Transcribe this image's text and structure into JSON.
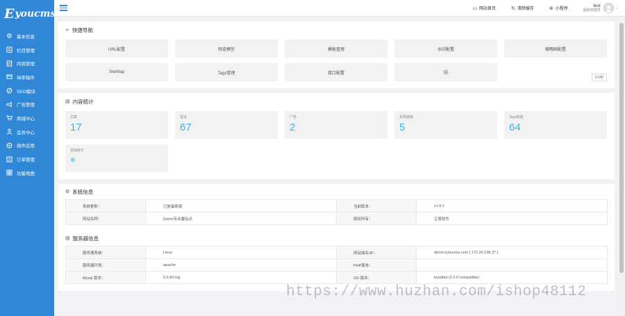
{
  "logo": {
    "text": "Eyoucms"
  },
  "sidebar": {
    "items": [
      {
        "label": "基本信息",
        "icon": "gear-icon"
      },
      {
        "label": "栏目管理",
        "icon": "sitemap-icon"
      },
      {
        "label": "内容管理",
        "icon": "document-icon"
      },
      {
        "label": "待审稿件",
        "icon": "pending-icon"
      },
      {
        "label": "SEO模块",
        "icon": "seo-icon"
      },
      {
        "label": "广告管理",
        "icon": "megaphone-icon"
      },
      {
        "label": "商城中心",
        "icon": "cart-icon"
      },
      {
        "label": "会员中心",
        "icon": "user-icon"
      },
      {
        "label": "插件应用",
        "icon": "plugin-icon"
      },
      {
        "label": "订单管理",
        "icon": "order-icon"
      },
      {
        "label": "功能地图",
        "icon": "grid-icon"
      }
    ]
  },
  "header": {
    "links": [
      {
        "label": "网站首页",
        "icon": "monitor-icon",
        "glyph": "▭"
      },
      {
        "label": "清除缓存",
        "icon": "refresh-icon",
        "glyph": "↻"
      },
      {
        "label": "小程序",
        "icon": "miniapp-icon",
        "glyph": "⊛"
      }
    ],
    "user": {
      "name": "test",
      "role": "超级管理员"
    }
  },
  "quick_nav": {
    "title": "快捷导航",
    "items": [
      "URL配置",
      "频道模型",
      "模板管理",
      "水印配置",
      "缩略图配置",
      "SiteMap",
      "Tags管理",
      "接口配置"
    ],
    "plus": "⊕",
    "sort_label": "0.5秒"
  },
  "content_stats": {
    "title": "内容统计",
    "items": [
      {
        "label": "文章",
        "value": "17"
      },
      {
        "label": "留言",
        "value": "67"
      },
      {
        "label": "广告",
        "value": "2"
      },
      {
        "label": "友情链接",
        "value": "5"
      },
      {
        "label": "Tags标签",
        "value": "64"
      }
    ],
    "add": {
      "label": "添加统计",
      "glyph": "⊕"
    }
  },
  "system_info": {
    "title": "系统信息",
    "rows": [
      [
        "系统更新：",
        "已是最新版",
        "当前版本：",
        "v1.6.1"
      ],
      [
        "网站名称：",
        "Demo专业展站点",
        "版权所有：",
        "正版软件"
      ]
    ]
  },
  "server_info": {
    "title": "服务器信息",
    "rows": [
      [
        "服务器系统：",
        "Linux",
        "网站域名/IP：",
        "demo.eyoucms.com [ 172.20.238.37 ]"
      ],
      [
        "服务器环境：",
        "apache",
        "PHP版本：",
        ""
      ],
      [
        "Mysql 版本：",
        "5.6.50-log",
        "GD 版本：",
        "bundled (2.1.0 compatible)"
      ]
    ]
  },
  "watermark": "https://www.huzhan.com/ishop48112",
  "colors": {
    "sidebar": "#3087d6",
    "accent": "#3eb3e8",
    "background": "#f1f2f6"
  }
}
